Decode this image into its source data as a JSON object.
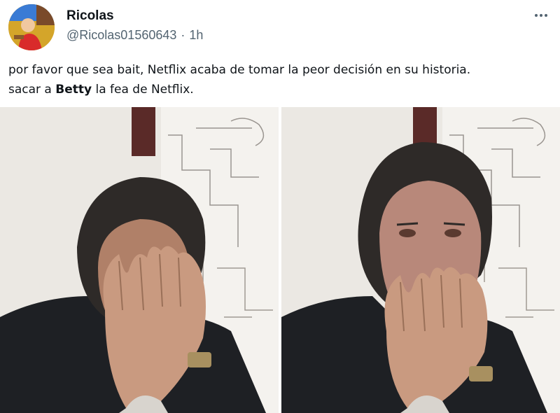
{
  "tweet": {
    "display_name": "Ricolas",
    "handle": "@Ricolas01560643",
    "separator": "·",
    "time": "1h",
    "text_line1": "por favor que sea bait, Netflix acaba de tomar la peor decisión en su historia.",
    "text_line2_prefix": "sacar a ",
    "text_line2_bold": "Betty",
    "text_line2_suffix": " la fea de Netflix."
  },
  "icons": {
    "more": "more-options-icon"
  },
  "media": {
    "images": [
      "man-covering-face-left",
      "man-covering-face-right"
    ]
  },
  "colors": {
    "text": "#0f1419",
    "secondary": "#536471",
    "background": "#ffffff"
  }
}
